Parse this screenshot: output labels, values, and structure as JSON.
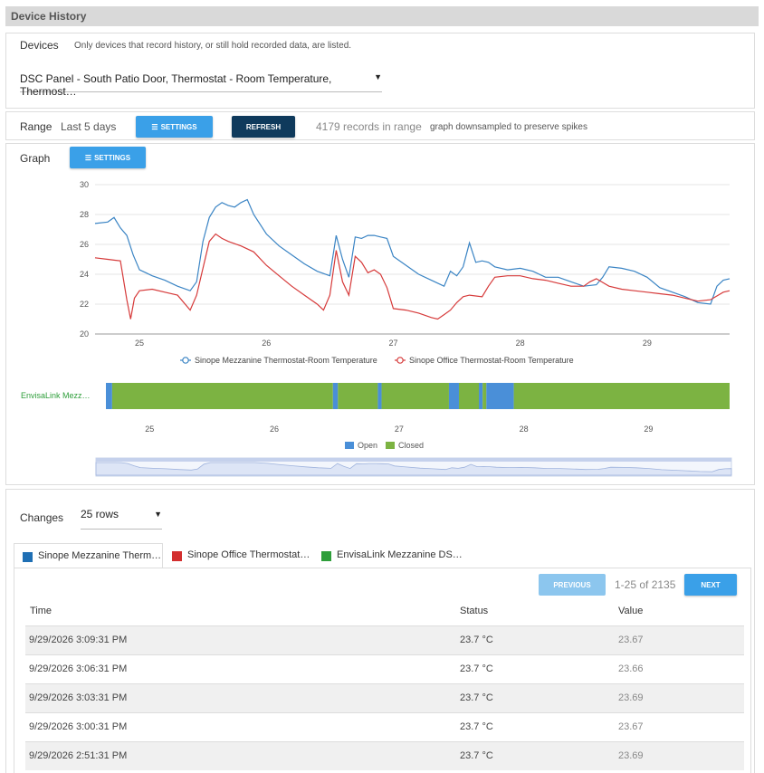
{
  "page_title": "Device History",
  "devices": {
    "label": "Devices",
    "hint": "Only devices that record history, or still hold recorded data, are listed.",
    "selected": "DSC Panel - South Patio Door, Thermostat - Room Temperature, Thermost…"
  },
  "range": {
    "label": "Range",
    "value": "Last 5 days",
    "settings_label": "SETTINGS",
    "refresh_label": "REFRESH",
    "records": "4179 records in range",
    "note": "graph downsampled to preserve spikes"
  },
  "graph": {
    "label": "Graph",
    "settings_label": "SETTINGS",
    "legend_open": "Open",
    "legend_closed": "Closed",
    "state_row_label": "EnvisaLink Mezz…"
  },
  "colors": {
    "series1": "#3a84c4",
    "series2": "#d63a3a",
    "open": "#4a8fd8",
    "closed": "#7cb342",
    "accent": "#3aa0e8",
    "dark_button": "#0f3a5c"
  },
  "chart_data": {
    "type": "line",
    "x_ticks": [
      "25",
      "26",
      "27",
      "28",
      "29"
    ],
    "y_ticks": [
      "20",
      "22",
      "24",
      "26",
      "28",
      "30"
    ],
    "ylim": [
      20,
      30
    ],
    "xlim": [
      24.65,
      29.65
    ],
    "grid": true,
    "legend_position": "bottom",
    "series": [
      {
        "name": "Sinope Mezzanine Thermostat-Room Temperature",
        "points": [
          [
            24.65,
            27.4
          ],
          [
            24.75,
            27.5
          ],
          [
            24.8,
            27.8
          ],
          [
            24.85,
            27.1
          ],
          [
            24.9,
            26.6
          ],
          [
            24.95,
            25.3
          ],
          [
            25.0,
            24.3
          ],
          [
            25.05,
            24.1
          ],
          [
            25.1,
            23.9
          ],
          [
            25.2,
            23.6
          ],
          [
            25.3,
            23.2
          ],
          [
            25.4,
            22.9
          ],
          [
            25.45,
            23.5
          ],
          [
            25.5,
            26.2
          ],
          [
            25.55,
            27.8
          ],
          [
            25.6,
            28.5
          ],
          [
            25.65,
            28.8
          ],
          [
            25.7,
            28.6
          ],
          [
            25.75,
            28.5
          ],
          [
            25.8,
            28.8
          ],
          [
            25.85,
            29.0
          ],
          [
            25.9,
            28.0
          ],
          [
            26.0,
            26.7
          ],
          [
            26.1,
            25.9
          ],
          [
            26.2,
            25.3
          ],
          [
            26.3,
            24.7
          ],
          [
            26.4,
            24.2
          ],
          [
            26.5,
            23.9
          ],
          [
            26.55,
            26.6
          ],
          [
            26.6,
            25.0
          ],
          [
            26.65,
            23.8
          ],
          [
            26.7,
            26.5
          ],
          [
            26.75,
            26.4
          ],
          [
            26.8,
            26.6
          ],
          [
            26.85,
            26.6
          ],
          [
            26.9,
            26.5
          ],
          [
            26.95,
            26.4
          ],
          [
            27.0,
            25.2
          ],
          [
            27.1,
            24.6
          ],
          [
            27.2,
            24.0
          ],
          [
            27.3,
            23.6
          ],
          [
            27.4,
            23.2
          ],
          [
            27.45,
            24.2
          ],
          [
            27.5,
            23.9
          ],
          [
            27.55,
            24.5
          ],
          [
            27.6,
            26.1
          ],
          [
            27.65,
            24.8
          ],
          [
            27.7,
            24.9
          ],
          [
            27.75,
            24.8
          ],
          [
            27.8,
            24.5
          ],
          [
            27.9,
            24.3
          ],
          [
            28.0,
            24.4
          ],
          [
            28.1,
            24.2
          ],
          [
            28.2,
            23.8
          ],
          [
            28.3,
            23.8
          ],
          [
            28.4,
            23.5
          ],
          [
            28.5,
            23.2
          ],
          [
            28.6,
            23.3
          ],
          [
            28.65,
            23.8
          ],
          [
            28.7,
            24.5
          ],
          [
            28.8,
            24.4
          ],
          [
            28.9,
            24.2
          ],
          [
            29.0,
            23.8
          ],
          [
            29.1,
            23.1
          ],
          [
            29.2,
            22.8
          ],
          [
            29.3,
            22.5
          ],
          [
            29.4,
            22.1
          ],
          [
            29.5,
            22.0
          ],
          [
            29.55,
            23.2
          ],
          [
            29.6,
            23.6
          ],
          [
            29.65,
            23.7
          ]
        ]
      },
      {
        "name": "Sinope Office Thermostat-Room Temperature",
        "points": [
          [
            24.65,
            25.1
          ],
          [
            24.75,
            25.0
          ],
          [
            24.85,
            24.9
          ],
          [
            24.9,
            22.3
          ],
          [
            24.93,
            21.0
          ],
          [
            24.96,
            22.4
          ],
          [
            25.0,
            22.9
          ],
          [
            25.1,
            23.0
          ],
          [
            25.2,
            22.8
          ],
          [
            25.3,
            22.6
          ],
          [
            25.4,
            21.6
          ],
          [
            25.45,
            22.6
          ],
          [
            25.5,
            24.4
          ],
          [
            25.55,
            26.2
          ],
          [
            25.6,
            26.7
          ],
          [
            25.65,
            26.4
          ],
          [
            25.7,
            26.2
          ],
          [
            25.8,
            25.9
          ],
          [
            25.9,
            25.5
          ],
          [
            26.0,
            24.6
          ],
          [
            26.1,
            23.9
          ],
          [
            26.2,
            23.2
          ],
          [
            26.3,
            22.6
          ],
          [
            26.4,
            22.0
          ],
          [
            26.45,
            21.6
          ],
          [
            26.5,
            22.6
          ],
          [
            26.55,
            25.6
          ],
          [
            26.6,
            23.5
          ],
          [
            26.65,
            22.6
          ],
          [
            26.7,
            25.2
          ],
          [
            26.75,
            24.8
          ],
          [
            26.8,
            24.1
          ],
          [
            26.85,
            24.3
          ],
          [
            26.9,
            24.0
          ],
          [
            26.95,
            23.1
          ],
          [
            27.0,
            21.7
          ],
          [
            27.1,
            21.6
          ],
          [
            27.2,
            21.4
          ],
          [
            27.3,
            21.1
          ],
          [
            27.35,
            21.0
          ],
          [
            27.4,
            21.3
          ],
          [
            27.45,
            21.6
          ],
          [
            27.5,
            22.1
          ],
          [
            27.55,
            22.5
          ],
          [
            27.6,
            22.6
          ],
          [
            27.7,
            22.5
          ],
          [
            27.75,
            23.2
          ],
          [
            27.8,
            23.8
          ],
          [
            27.9,
            23.9
          ],
          [
            28.0,
            23.9
          ],
          [
            28.1,
            23.7
          ],
          [
            28.2,
            23.6
          ],
          [
            28.3,
            23.4
          ],
          [
            28.4,
            23.2
          ],
          [
            28.5,
            23.2
          ],
          [
            28.55,
            23.5
          ],
          [
            28.6,
            23.7
          ],
          [
            28.7,
            23.2
          ],
          [
            28.8,
            23.0
          ],
          [
            28.9,
            22.9
          ],
          [
            29.0,
            22.8
          ],
          [
            29.1,
            22.7
          ],
          [
            29.2,
            22.6
          ],
          [
            29.3,
            22.4
          ],
          [
            29.4,
            22.2
          ],
          [
            29.5,
            22.3
          ],
          [
            29.6,
            22.8
          ],
          [
            29.65,
            22.9
          ]
        ]
      }
    ],
    "state_series": {
      "name": "EnvisaLink Mezzanine",
      "states": [
        [
          "Open",
          24.65,
          24.7
        ],
        [
          "Closed",
          24.7,
          26.47
        ],
        [
          "Open",
          26.47,
          26.51
        ],
        [
          "Closed",
          26.51,
          26.83
        ],
        [
          "Open",
          26.83,
          26.86
        ],
        [
          "Closed",
          26.86,
          27.4
        ],
        [
          "Open",
          27.4,
          27.48
        ],
        [
          "Closed",
          27.48,
          27.64
        ],
        [
          "Open",
          27.64,
          27.67
        ],
        [
          "Closed",
          27.67,
          27.7
        ],
        [
          "Open",
          27.7,
          27.92
        ],
        [
          "Closed",
          27.92,
          29.65
        ]
      ]
    }
  },
  "changes": {
    "label": "Changes",
    "rows_select": "25 rows",
    "tabs": [
      {
        "label": "Sinope Mezzanine Therm…",
        "color": "#1f6fb4"
      },
      {
        "label": "Sinope Office Thermostat…",
        "color": "#d32f2f"
      },
      {
        "label": "EnvisaLink Mezzanine DS…",
        "color": "#2e9e3a"
      }
    ],
    "previous_label": "PREVIOUS",
    "next_label": "NEXT",
    "pager_text": "1-25 of 2135",
    "columns": [
      "Time",
      "Status",
      "Value"
    ],
    "rows": [
      {
        "time": "9/29/2026 3:09:31 PM",
        "status": "23.7 °C",
        "value": "23.67"
      },
      {
        "time": "9/29/2026 3:06:31 PM",
        "status": "23.7 °C",
        "value": "23.66"
      },
      {
        "time": "9/29/2026 3:03:31 PM",
        "status": "23.7 °C",
        "value": "23.69"
      },
      {
        "time": "9/29/2026 3:00:31 PM",
        "status": "23.7 °C",
        "value": "23.67"
      },
      {
        "time": "9/29/2026 2:51:31 PM",
        "status": "23.7 °C",
        "value": "23.69"
      }
    ]
  }
}
